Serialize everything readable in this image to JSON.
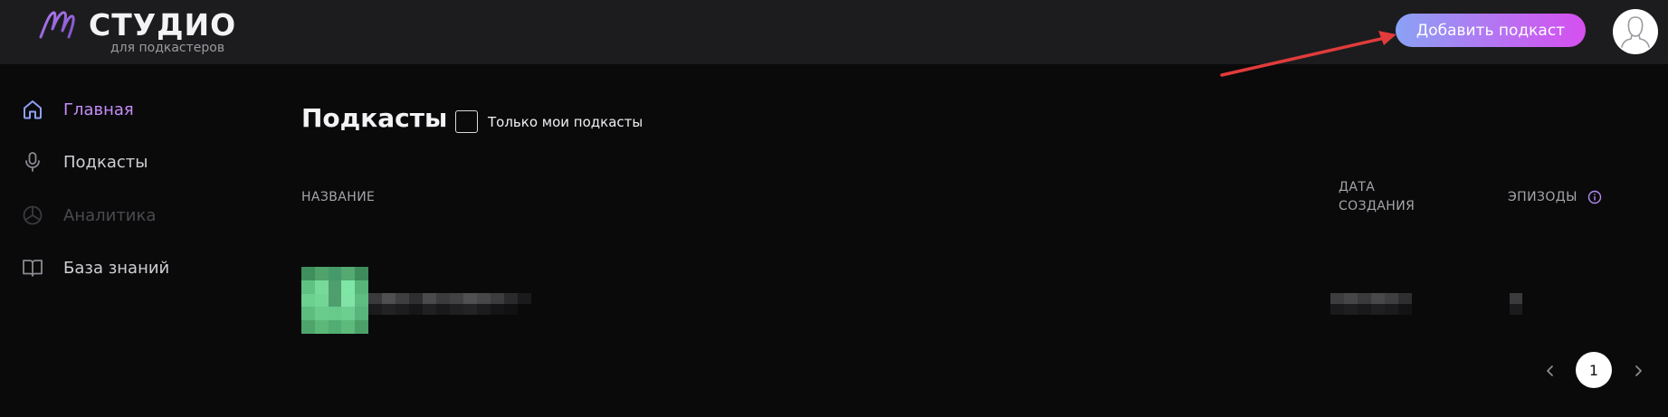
{
  "header": {
    "logo_title": "СТУДИО",
    "logo_subtitle": "для подкастеров",
    "add_podcast_label": "Добавить подкаст",
    "accent_gradient": [
      "#8aa2f5",
      "#b772f2",
      "#d64ff0"
    ]
  },
  "sidebar": {
    "items": [
      {
        "label": "Главная",
        "icon": "home-icon",
        "state": "active"
      },
      {
        "label": "Подкасты",
        "icon": "microphone-icon",
        "state": "normal"
      },
      {
        "label": "Аналитика",
        "icon": "pie-chart-icon",
        "state": "disabled"
      },
      {
        "label": "База знаний",
        "icon": "book-icon",
        "state": "normal"
      }
    ]
  },
  "main": {
    "title": "Подкасты",
    "filter_label": "Только мои подкасты",
    "filter_checked": false,
    "columns": {
      "name": "НАЗВАНИЕ",
      "date_line1": "ДАТА",
      "date_line2": "СОЗДАНИЯ",
      "episodes": "ЭПИЗОДЫ"
    },
    "rows_redacted": true
  },
  "pagination": {
    "current_page": "1"
  },
  "colors": {
    "background": "#0a0a0b",
    "header": "#1c1c1e",
    "active_nav": "#c48df6",
    "annotation_arrow": "#e23b3b"
  }
}
